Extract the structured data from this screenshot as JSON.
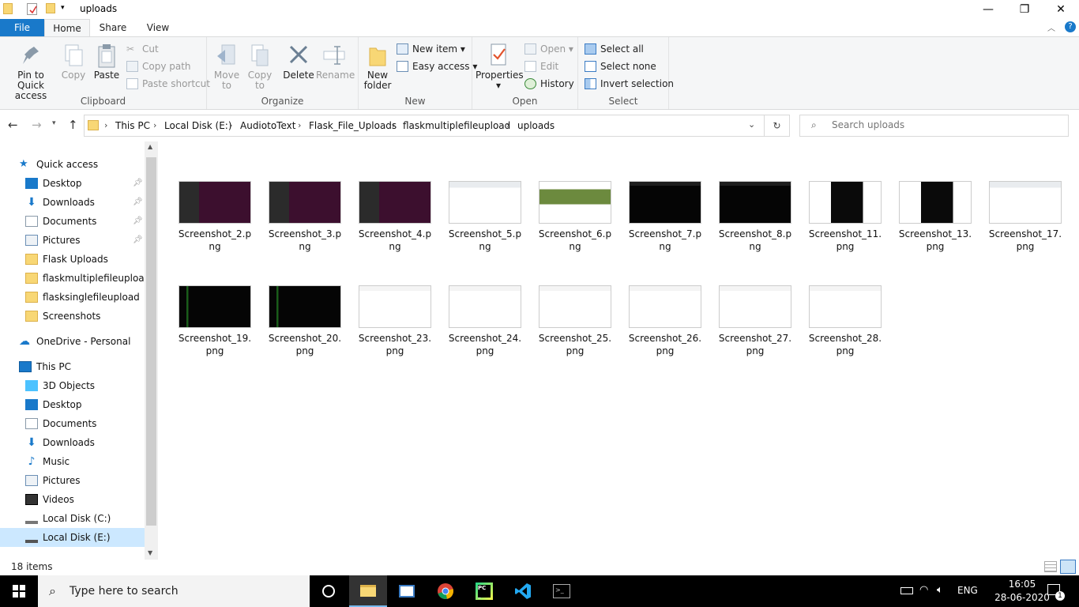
{
  "window": {
    "title": "uploads",
    "minimize": "—",
    "restore": "❐",
    "close": "✕"
  },
  "tabs": {
    "file": "File",
    "home": "Home",
    "share": "Share",
    "view": "View"
  },
  "ribbon": {
    "clipboard": {
      "label": "Clipboard",
      "pin": "Pin to Quick access",
      "copy": "Copy",
      "paste": "Paste",
      "cut": "Cut",
      "copy_path": "Copy path",
      "paste_shortcut": "Paste shortcut"
    },
    "organize": {
      "label": "Organize",
      "move_to": "Move to",
      "copy_to": "Copy to",
      "delete": "Delete",
      "rename": "Rename"
    },
    "new": {
      "label": "New",
      "new_folder": "New folder",
      "new_item": "New item",
      "easy_access": "Easy access"
    },
    "open": {
      "label": "Open",
      "properties": "Properties",
      "open": "Open",
      "edit": "Edit",
      "history": "History"
    },
    "select": {
      "label": "Select",
      "select_all": "Select all",
      "select_none": "Select none",
      "invert_selection": "Invert selection"
    }
  },
  "address": {
    "crumbs": [
      "This PC",
      "Local Disk (E:)",
      "AudiotoText",
      "Flask_File_Uploads",
      "flaskmultiplefileupload",
      "uploads"
    ]
  },
  "search": {
    "placeholder": "Search uploads"
  },
  "nav": {
    "quick_access": "Quick access",
    "quick_items": [
      "Desktop",
      "Downloads",
      "Documents",
      "Pictures",
      "Flask Uploads",
      "flaskmultiplefileupload",
      "flasksinglefileupload",
      "Screenshots"
    ],
    "onedrive": "OneDrive - Personal",
    "this_pc": "This PC",
    "pc_items": [
      "3D Objects",
      "Desktop",
      "Documents",
      "Downloads",
      "Music",
      "Pictures",
      "Videos",
      "Local Disk (C:)",
      "Local Disk (E:)"
    ]
  },
  "files": [
    {
      "name": "Screenshot_2.png",
      "theme": "ubuntu"
    },
    {
      "name": "Screenshot_3.png",
      "theme": "ubuntu"
    },
    {
      "name": "Screenshot_4.png",
      "theme": "ubuntu"
    },
    {
      "name": "Screenshot_5.png",
      "theme": "light"
    },
    {
      "name": "Screenshot_6.png",
      "theme": "web"
    },
    {
      "name": "Screenshot_7.png",
      "theme": "dark"
    },
    {
      "name": "Screenshot_8.png",
      "theme": "dark"
    },
    {
      "name": "Screenshot_11.png",
      "theme": "mixed"
    },
    {
      "name": "Screenshot_13.png",
      "theme": "mixed"
    },
    {
      "name": "Screenshot_17.png",
      "theme": "light"
    },
    {
      "name": "Screenshot_19.png",
      "theme": "terminal"
    },
    {
      "name": "Screenshot_20.png",
      "theme": "terminal"
    },
    {
      "name": "Screenshot_23.png",
      "theme": "blank"
    },
    {
      "name": "Screenshot_24.png",
      "theme": "blank"
    },
    {
      "name": "Screenshot_25.png",
      "theme": "blank"
    },
    {
      "name": "Screenshot_26.png",
      "theme": "blank"
    },
    {
      "name": "Screenshot_27.png",
      "theme": "blank"
    },
    {
      "name": "Screenshot_28.png",
      "theme": "blank"
    }
  ],
  "status": {
    "count": "18 items"
  },
  "taskbar": {
    "search_placeholder": "Type here to search",
    "lang": "ENG",
    "time": "16:05",
    "date": "28-06-2020",
    "notif_count": "1"
  },
  "colors": {
    "accent": "#1979ca",
    "folder": "#f8d775",
    "ribbon_bg": "#f5f6f7"
  }
}
